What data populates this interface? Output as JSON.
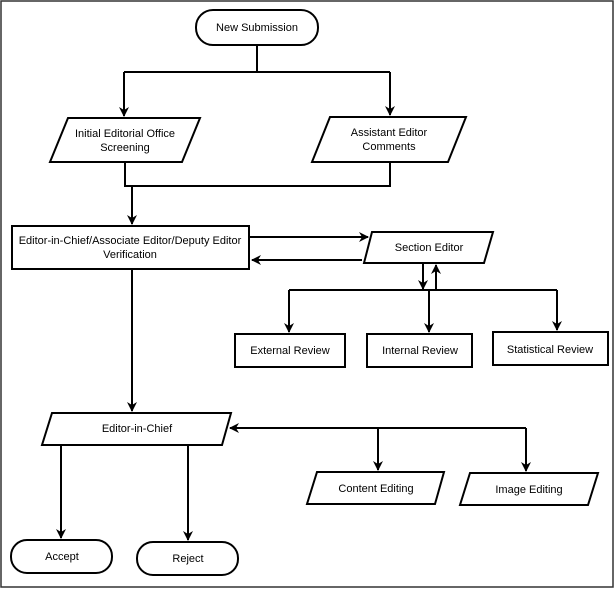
{
  "nodes": {
    "new_submission": "New Submission",
    "initial_screening": [
      "Initial Editorial Office",
      "Screening"
    ],
    "assistant_editor": [
      "Assistant Editor",
      "Comments"
    ],
    "verification": [
      "Editor-in-Chief/Associate Editor/Deputy Editor",
      "Verification"
    ],
    "section_editor": "Section Editor",
    "external_review": "External Review",
    "internal_review": "Internal Review",
    "statistical_review": "Statistical Review",
    "editor_in_chief": "Editor-in-Chief",
    "content_editing": "Content Editing",
    "image_editing": "Image Editing",
    "accept": "Accept",
    "reject": "Reject"
  },
  "colors": {
    "stroke": "#000000",
    "fill": "#ffffff"
  }
}
